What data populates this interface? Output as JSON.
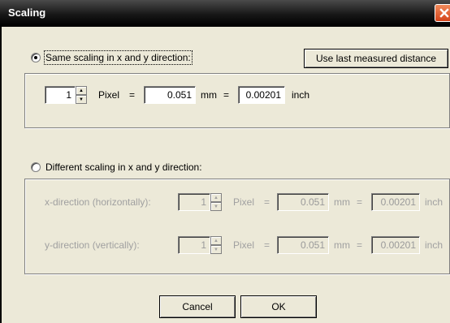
{
  "window": {
    "title": "Scaling"
  },
  "same": {
    "radio_label": "Same scaling in x and y direction:",
    "selected": true,
    "use_last_button": "Use last measured distance",
    "pixel_value": "1",
    "pixel_label": "Pixel",
    "eq1": "=",
    "mm_value": "0.051",
    "mm_label": "mm",
    "eq2": "=",
    "inch_value": "0.00201",
    "inch_label": "inch"
  },
  "different": {
    "radio_label": "Different scaling in x and y direction:",
    "selected": false,
    "x": {
      "label": "x-direction (horizontally):",
      "pixel_value": "1",
      "pixel_label": "Pixel",
      "eq1": "=",
      "mm_value": "0.051",
      "mm_label": "mm",
      "eq2": "=",
      "inch_value": "0.00201",
      "inch_label": "inch"
    },
    "y": {
      "label": "y-direction (vertically):",
      "pixel_value": "1",
      "pixel_label": "Pixel",
      "eq1": "=",
      "mm_value": "0.051",
      "mm_label": "mm",
      "eq2": "=",
      "inch_value": "0.00201",
      "inch_label": "inch"
    }
  },
  "buttons": {
    "cancel": "Cancel",
    "ok": "OK"
  },
  "icons": {
    "close": "close-icon",
    "spin_up": "arrow-up-icon",
    "spin_down": "arrow-down-icon"
  },
  "colors": {
    "dialog_bg": "#ece9d8",
    "titlebar": "#000000",
    "close_button": "#e0562b",
    "disabled_text": "#a0a0a0"
  }
}
